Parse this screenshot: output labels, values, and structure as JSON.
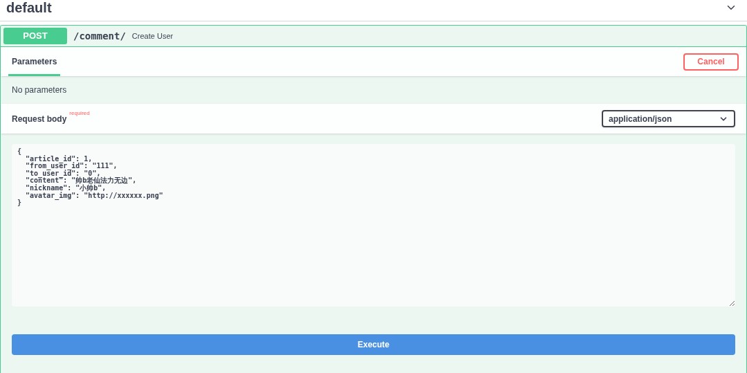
{
  "section": {
    "title": "default",
    "expanded": true
  },
  "operation": {
    "method": "POST",
    "path": "/comment/",
    "summary": "Create User"
  },
  "tabs": [
    {
      "label": "Parameters",
      "selected": true
    }
  ],
  "cancel_button": "Cancel",
  "parameters": {
    "empty_text": "No parameters"
  },
  "request_body": {
    "label": "Request body",
    "required_mark": "required",
    "content_type": "application/json",
    "value": "{\n  \"article_id\": 1,\n  \"from_user_id\": \"111\",\n  \"to_user_id\": \"0\",\n  \"content\": \"帅b老仙法力无边\",\n  \"nickname\": \"小帅b\",\n  \"avatar_img\": \"http://xxxxxx.png\"\n}"
  },
  "execute_button": "Execute"
}
